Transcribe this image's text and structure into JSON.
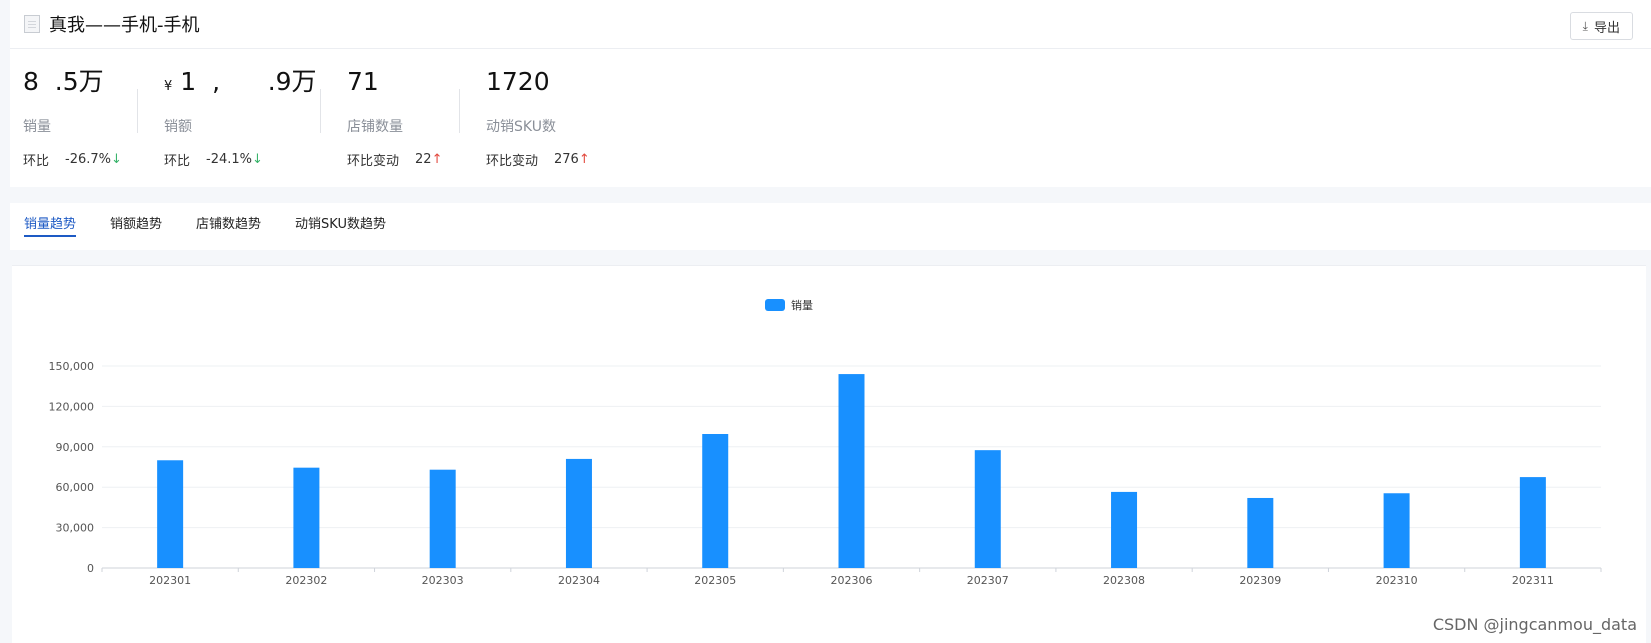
{
  "header": {
    "title": "真我——手机-手机",
    "export_label": "导出"
  },
  "stats": [
    {
      "value": "8  .5万",
      "label": "销量",
      "compare_label": "环比",
      "compare_value": "-26.7%",
      "direction": "down"
    },
    {
      "currency": "¥",
      "value": "1  ,      .9万",
      "label": "销额",
      "compare_label": "环比",
      "compare_value": "-24.1%",
      "direction": "down"
    },
    {
      "value": "71",
      "label": "店铺数量",
      "compare_label": "环比变动",
      "compare_value": "22",
      "direction": "up"
    },
    {
      "value": "1720",
      "label": "动销SKU数",
      "compare_label": "环比变动",
      "compare_value": "276",
      "direction": "up"
    }
  ],
  "tabs": [
    {
      "label": "销量趋势",
      "active": true
    },
    {
      "label": "销额趋势",
      "active": false
    },
    {
      "label": "店铺数趋势",
      "active": false
    },
    {
      "label": "动销SKU数趋势",
      "active": false
    }
  ],
  "chart_data": {
    "type": "bar",
    "categories": [
      "202301",
      "202302",
      "202303",
      "202304",
      "202305",
      "202306",
      "202307",
      "202308",
      "202309",
      "202310",
      "202311"
    ],
    "series": [
      {
        "name": "销量",
        "values": [
          80000,
          74500,
          73000,
          81000,
          99500,
          144000,
          87500,
          56500,
          52000,
          55500,
          67500
        ]
      }
    ],
    "yticks": [
      0,
      30000,
      60000,
      90000,
      120000,
      150000
    ],
    "ytick_labels": [
      "0",
      "30,000",
      "60,000",
      "90,000",
      "120,000",
      "150,000"
    ],
    "ylim": [
      0,
      150000
    ],
    "grid": true,
    "legend": "top-center",
    "color": "#1890ff",
    "title": "",
    "xlabel": "",
    "ylabel": ""
  },
  "watermark": "CSDN @jingcanmou_data"
}
